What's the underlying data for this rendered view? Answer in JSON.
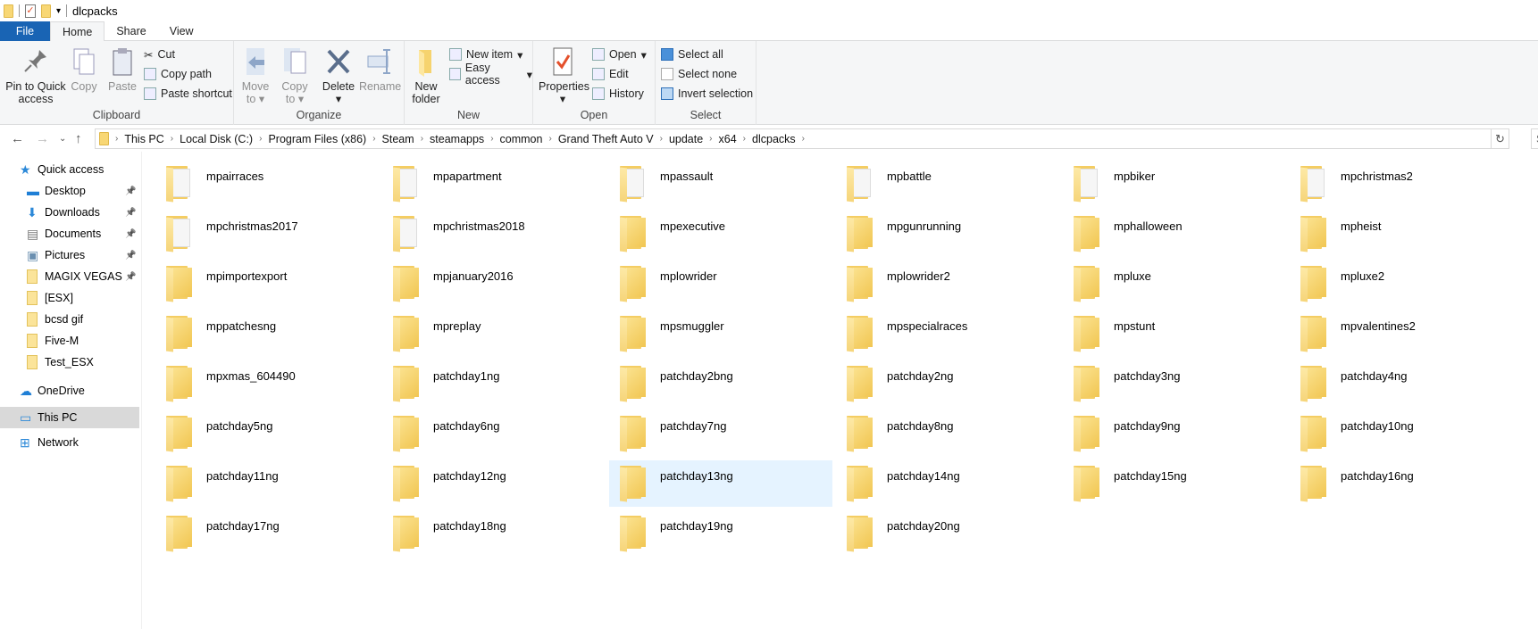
{
  "window": {
    "title": "dlcpacks"
  },
  "tabs": [
    {
      "label": "File"
    },
    {
      "label": "Home"
    },
    {
      "label": "Share"
    },
    {
      "label": "View"
    }
  ],
  "ribbon": {
    "clipboard": {
      "label": "Clipboard",
      "pin": "Pin to Quick access",
      "copy": "Copy",
      "paste": "Paste",
      "cut": "Cut",
      "copy_path": "Copy path",
      "paste_shortcut": "Paste shortcut"
    },
    "organize": {
      "label": "Organize",
      "move_to": "Move to",
      "copy_to": "Copy to",
      "delete": "Delete",
      "rename": "Rename"
    },
    "new": {
      "label": "New",
      "new_folder": "New folder",
      "new_item": "New item",
      "easy_access": "Easy access"
    },
    "open": {
      "label": "Open",
      "properties": "Properties",
      "open": "Open",
      "edit": "Edit",
      "history": "History"
    },
    "select": {
      "label": "Select",
      "select_all": "Select all",
      "select_none": "Select none",
      "invert": "Invert selection"
    }
  },
  "address": {
    "crumbs": [
      "This PC",
      "Local Disk (C:)",
      "Program Files (x86)",
      "Steam",
      "steamapps",
      "common",
      "Grand Theft Auto V",
      "update",
      "x64",
      "dlcpacks"
    ],
    "search_placeholder": "S"
  },
  "sidebar": [
    {
      "label": "Quick access",
      "icon": "star-icon"
    },
    {
      "label": "Desktop",
      "icon": "desktop-icon",
      "pinned": true
    },
    {
      "label": "Downloads",
      "icon": "download-icon",
      "pinned": true
    },
    {
      "label": "Documents",
      "icon": "documents-icon",
      "pinned": true
    },
    {
      "label": "Pictures",
      "icon": "pictures-icon",
      "pinned": true
    },
    {
      "label": "MAGIX VEGAS Pro",
      "icon": "folder-icon",
      "pinned": true
    },
    {
      "label": "[ESX]",
      "icon": "folder-icon"
    },
    {
      "label": "bcsd gif",
      "icon": "folder-icon"
    },
    {
      "label": "Five-M",
      "icon": "folder-icon"
    },
    {
      "label": "Test_ESX",
      "icon": "folder-icon"
    },
    {
      "label": "OneDrive",
      "icon": "cloud-icon"
    },
    {
      "label": "This PC",
      "icon": "computer-icon",
      "selected": true
    },
    {
      "label": "Network",
      "icon": "network-icon"
    }
  ],
  "items": [
    {
      "name": "mpairraces",
      "doc": true
    },
    {
      "name": "mpapartment",
      "doc": true
    },
    {
      "name": "mpassault",
      "doc": true
    },
    {
      "name": "mpbattle",
      "doc": true
    },
    {
      "name": "mpbiker",
      "doc": true
    },
    {
      "name": "mpchristmas2",
      "doc": true
    },
    {
      "name": "mpchristmas2017",
      "doc": true
    },
    {
      "name": "mpchristmas2018",
      "doc": true
    },
    {
      "name": "mpexecutive"
    },
    {
      "name": "mpgunrunning"
    },
    {
      "name": "mphalloween"
    },
    {
      "name": "mpheist"
    },
    {
      "name": "mpimportexport"
    },
    {
      "name": "mpjanuary2016"
    },
    {
      "name": "mplowrider"
    },
    {
      "name": "mplowrider2"
    },
    {
      "name": "mpluxe"
    },
    {
      "name": "mpluxe2"
    },
    {
      "name": "mppatchesng"
    },
    {
      "name": "mpreplay"
    },
    {
      "name": "mpsmuggler"
    },
    {
      "name": "mpspecialraces"
    },
    {
      "name": "mpstunt"
    },
    {
      "name": "mpvalentines2"
    },
    {
      "name": "mpxmas_604490"
    },
    {
      "name": "patchday1ng"
    },
    {
      "name": "patchday2bng"
    },
    {
      "name": "patchday2ng"
    },
    {
      "name": "patchday3ng"
    },
    {
      "name": "patchday4ng"
    },
    {
      "name": "patchday5ng"
    },
    {
      "name": "patchday6ng"
    },
    {
      "name": "patchday7ng"
    },
    {
      "name": "patchday8ng"
    },
    {
      "name": "patchday9ng"
    },
    {
      "name": "patchday10ng"
    },
    {
      "name": "patchday11ng"
    },
    {
      "name": "patchday12ng"
    },
    {
      "name": "patchday13ng",
      "hover": true
    },
    {
      "name": "patchday14ng"
    },
    {
      "name": "patchday15ng"
    },
    {
      "name": "patchday16ng"
    },
    {
      "name": "patchday17ng"
    },
    {
      "name": "patchday18ng"
    },
    {
      "name": "patchday19ng"
    },
    {
      "name": "patchday20ng"
    }
  ]
}
